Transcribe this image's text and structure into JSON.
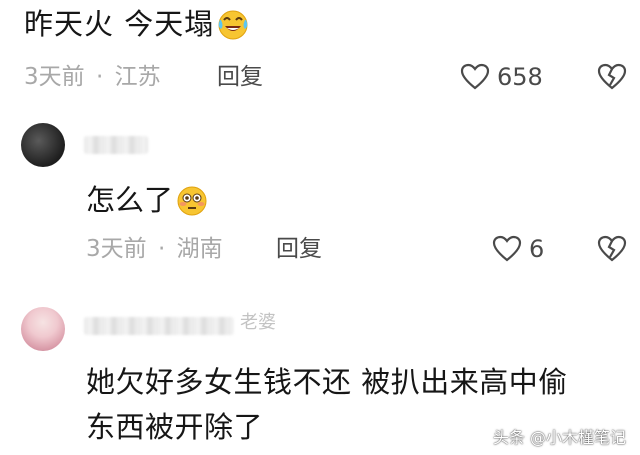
{
  "comments": [
    {
      "text": "昨天火 今天塌",
      "emoji": "crying-laughing-face",
      "time": "3天前",
      "separator": "·",
      "location": "江苏",
      "reply_label": "回复",
      "likes": "658"
    },
    {
      "text": "怎么了",
      "emoji": "flushed-face",
      "time": "3天前",
      "separator": "·",
      "location": "湖南",
      "reply_label": "回复",
      "likes": "6"
    },
    {
      "username_partial": "老婆",
      "text_line1": "她欠好多女生钱不还 被扒出来高中偷",
      "text_line2": "东西被开除了"
    }
  ],
  "watermark": "头条 @小木槿笔记",
  "colors": {
    "text": "#161616",
    "meta": "#a8a8a8",
    "action": "#4a4a4a",
    "background": "#ffffff"
  }
}
